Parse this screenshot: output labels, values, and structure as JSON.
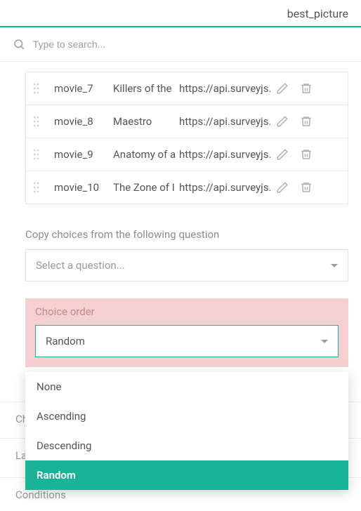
{
  "header": {
    "title": "best_picture"
  },
  "search": {
    "placeholder": "Type to search..."
  },
  "choices": [
    {
      "id": "movie_7",
      "title": "Killers of the Flower Moon",
      "url": "https://api.surveyjs.io"
    },
    {
      "id": "movie_8",
      "title": "Maestro",
      "url": "https://api.surveyjs.io"
    },
    {
      "id": "movie_9",
      "title": "Anatomy of a Fall",
      "url": "https://api.surveyjs.io"
    },
    {
      "id": "movie_10",
      "title": "The Zone of Interest",
      "url": "https://api.surveyjs.io"
    }
  ],
  "copy_choices": {
    "label": "Copy choices from the following question",
    "placeholder": "Select a question..."
  },
  "choice_order": {
    "label": "Choice order",
    "selected": "Random",
    "options": [
      "None",
      "Ascending",
      "Descending",
      "Random"
    ]
  },
  "accordion": {
    "rate_values": "Choices from a Web Service",
    "layout": "Layout",
    "conditions": "Conditions"
  }
}
